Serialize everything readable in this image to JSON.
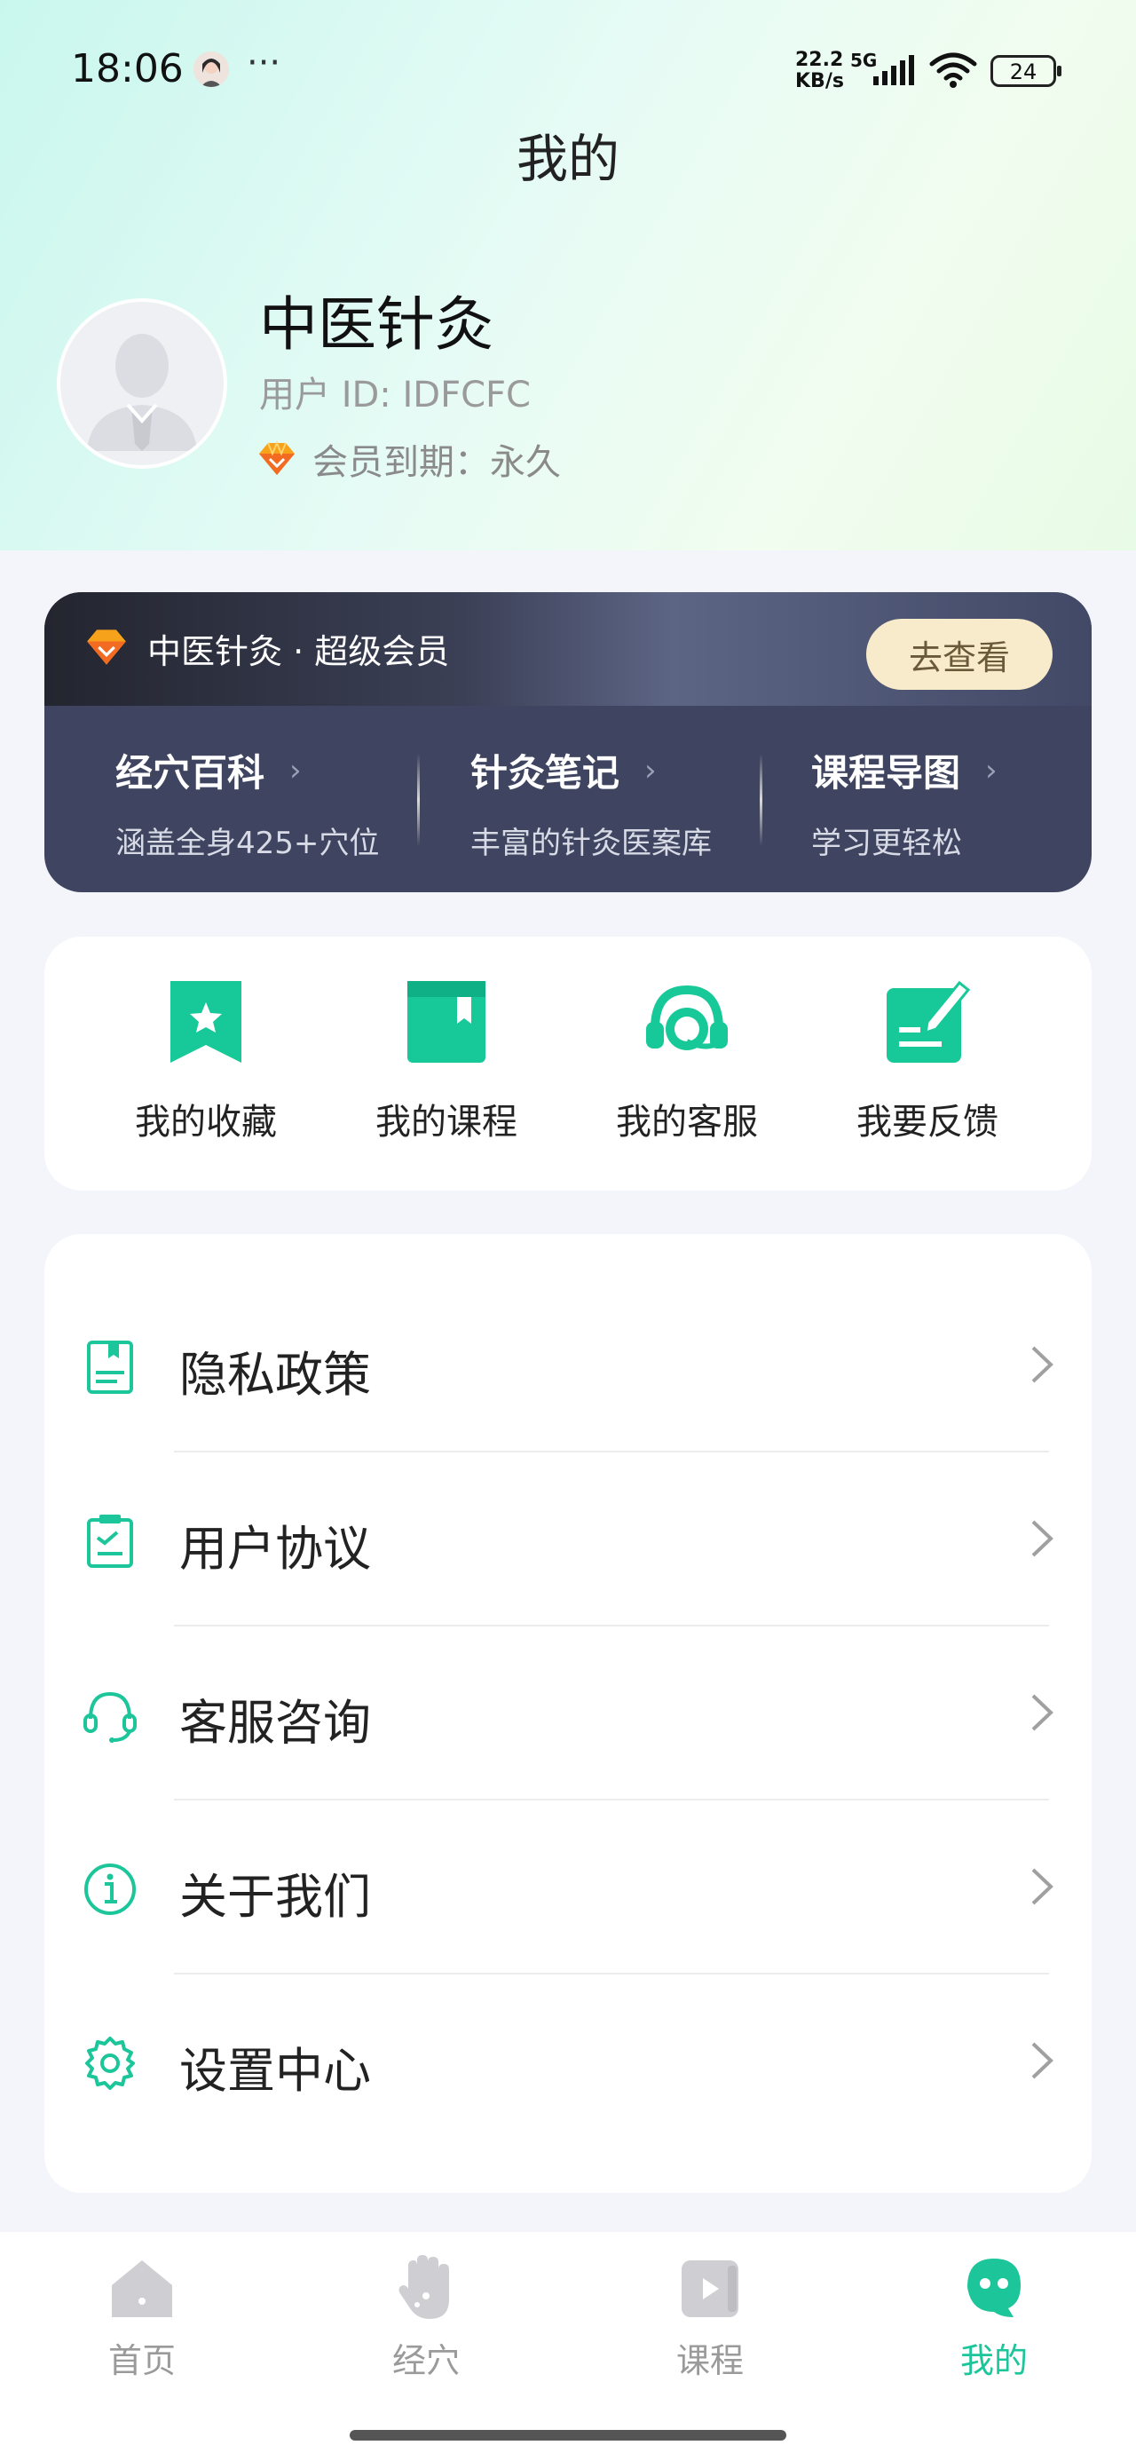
{
  "status_bar": {
    "time": "18:06",
    "more": "···",
    "net_speed_value": "22.2",
    "net_speed_unit": "KB/s",
    "network_type": "5G",
    "battery": "24"
  },
  "header": {
    "title": "我的"
  },
  "profile": {
    "name": "中医针灸",
    "user_id": "用户 ID: IDFCFC",
    "membership": "会员到期：永久"
  },
  "vip_card": {
    "title": "中医针灸 · 超级会员",
    "button": "去查看",
    "features": [
      {
        "title": "经穴百科",
        "subtitle": "涵盖全身425+穴位"
      },
      {
        "title": "针灸笔记",
        "subtitle": "丰富的针灸医案库"
      },
      {
        "title": "课程导图",
        "subtitle": "学习更轻松"
      }
    ]
  },
  "quick_actions": [
    {
      "label": "我的收藏",
      "icon": "bookmark-star-icon"
    },
    {
      "label": "我的课程",
      "icon": "book-icon"
    },
    {
      "label": "我的客服",
      "icon": "headset-icon"
    },
    {
      "label": "我要反馈",
      "icon": "feedback-pen-icon"
    }
  ],
  "menu": [
    {
      "label": "隐私政策",
      "icon": "document-icon"
    },
    {
      "label": "用户协议",
      "icon": "checklist-icon"
    },
    {
      "label": "客服咨询",
      "icon": "headset-icon"
    },
    {
      "label": "关于我们",
      "icon": "info-icon"
    },
    {
      "label": "设置中心",
      "icon": "settings-gear-icon"
    }
  ],
  "tab_bar": {
    "items": [
      {
        "label": "首页",
        "icon": "home-icon",
        "active": false
      },
      {
        "label": "经穴",
        "icon": "hand-acupoint-icon",
        "active": false
      },
      {
        "label": "课程",
        "icon": "video-play-icon",
        "active": false
      },
      {
        "label": "我的",
        "icon": "ghost-profile-icon",
        "active": true
      }
    ]
  },
  "colors": {
    "accent": "#1cc59a",
    "vip_dark": "#3f4560",
    "vip_button": "#f8ebcb"
  }
}
